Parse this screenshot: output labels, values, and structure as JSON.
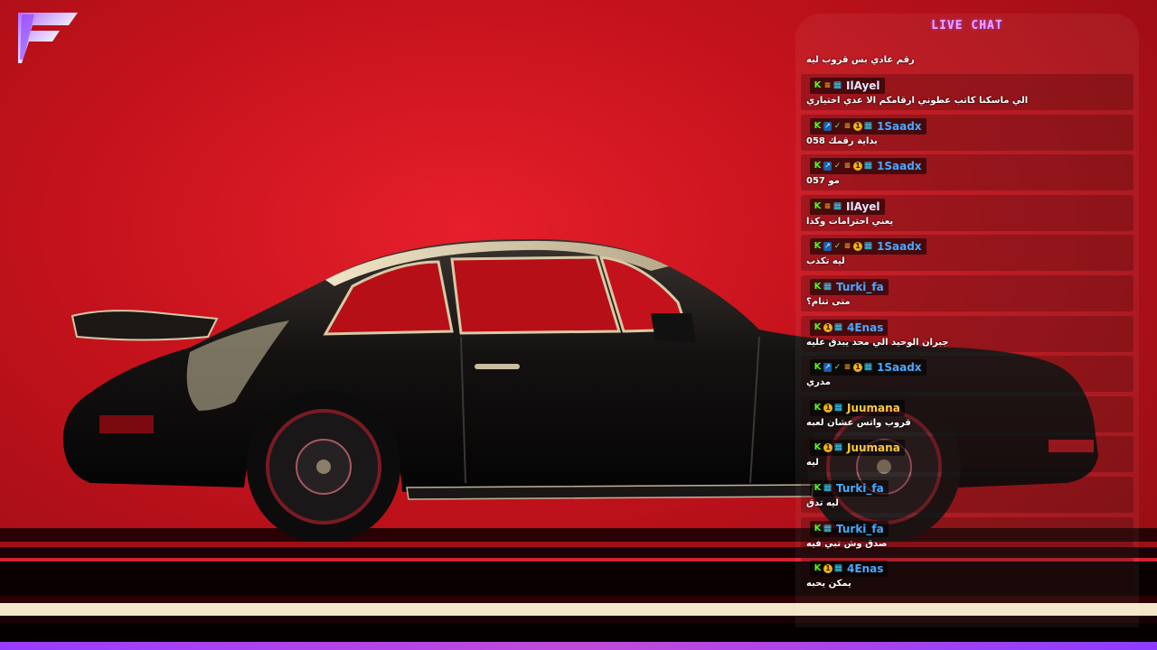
{
  "chat": {
    "title": "LIVE CHAT",
    "first_message": "رقم عادي بس قروب ليه",
    "messages": [
      {
        "user": "IlAyel",
        "color": "#e6e6ff",
        "badges": [
          "kick",
          "gift",
          "grid"
        ],
        "text": "الي ماسكنا كاتب عطوني ارقامكم الا عدي اختياري"
      },
      {
        "user": "1Saadx",
        "color": "#4aa8ff",
        "badges": [
          "kick",
          "sub",
          "ok",
          "gift",
          "coin",
          "grid"
        ],
        "text": "بداية رقمك 058"
      },
      {
        "user": "1Saadx",
        "color": "#4aa8ff",
        "badges": [
          "kick",
          "sub",
          "ok",
          "gift",
          "coin",
          "grid"
        ],
        "text": "مو 057"
      },
      {
        "user": "IlAyel",
        "color": "#e6e6ff",
        "badges": [
          "kick",
          "gift",
          "grid"
        ],
        "text": "يعني احترامات وكذا"
      },
      {
        "user": "1Saadx",
        "color": "#4aa8ff",
        "badges": [
          "kick",
          "sub",
          "ok",
          "gift",
          "coin",
          "grid"
        ],
        "text": "ليه تكذب"
      },
      {
        "user": "Turki_fa",
        "color": "#4aa8ff",
        "badges": [
          "kick",
          "grid"
        ],
        "text": "متى تنام؟"
      },
      {
        "user": "4Enas",
        "color": "#4aa8ff",
        "badges": [
          "kick",
          "coin",
          "grid"
        ],
        "text": "جبران الوحيد الي محد يبدق عليه"
      },
      {
        "user": "1Saadx",
        "color": "#4aa8ff",
        "badges": [
          "kick",
          "sub",
          "ok",
          "gift",
          "coin",
          "grid"
        ],
        "text": "مدري"
      },
      {
        "user": "Juumana",
        "color": "#ffc83d",
        "badges": [
          "kick",
          "coin",
          "grid"
        ],
        "text": "قروب واتس عشان لعبه"
      },
      {
        "user": "Juumana",
        "color": "#ffc83d",
        "badges": [
          "kick",
          "coin",
          "grid"
        ],
        "text": "ليه"
      },
      {
        "user": "Turki_fa",
        "color": "#4aa8ff",
        "badges": [
          "kick",
          "grid"
        ],
        "text": "ليه تدق"
      },
      {
        "user": "Turki_fa",
        "color": "#4aa8ff",
        "badges": [
          "kick",
          "grid"
        ],
        "text": "صدق وش تبي فيه"
      },
      {
        "user": "4Enas",
        "color": "#4aa8ff",
        "badges": [
          "kick",
          "coin",
          "grid"
        ],
        "text": "يمكن يحبه"
      }
    ]
  },
  "badge_icons": {
    "kick": "kick-badge-icon",
    "sub": "subscriber-badge-icon",
    "ok": "verified-badge-icon",
    "gift": "gifter-badge-icon",
    "coin": "founder-badge-icon",
    "grid": "og-badge-icon"
  },
  "colors": {
    "background": "#c4121c",
    "accent": "#c14bd9",
    "chat_title": "#f4a6f4"
  }
}
